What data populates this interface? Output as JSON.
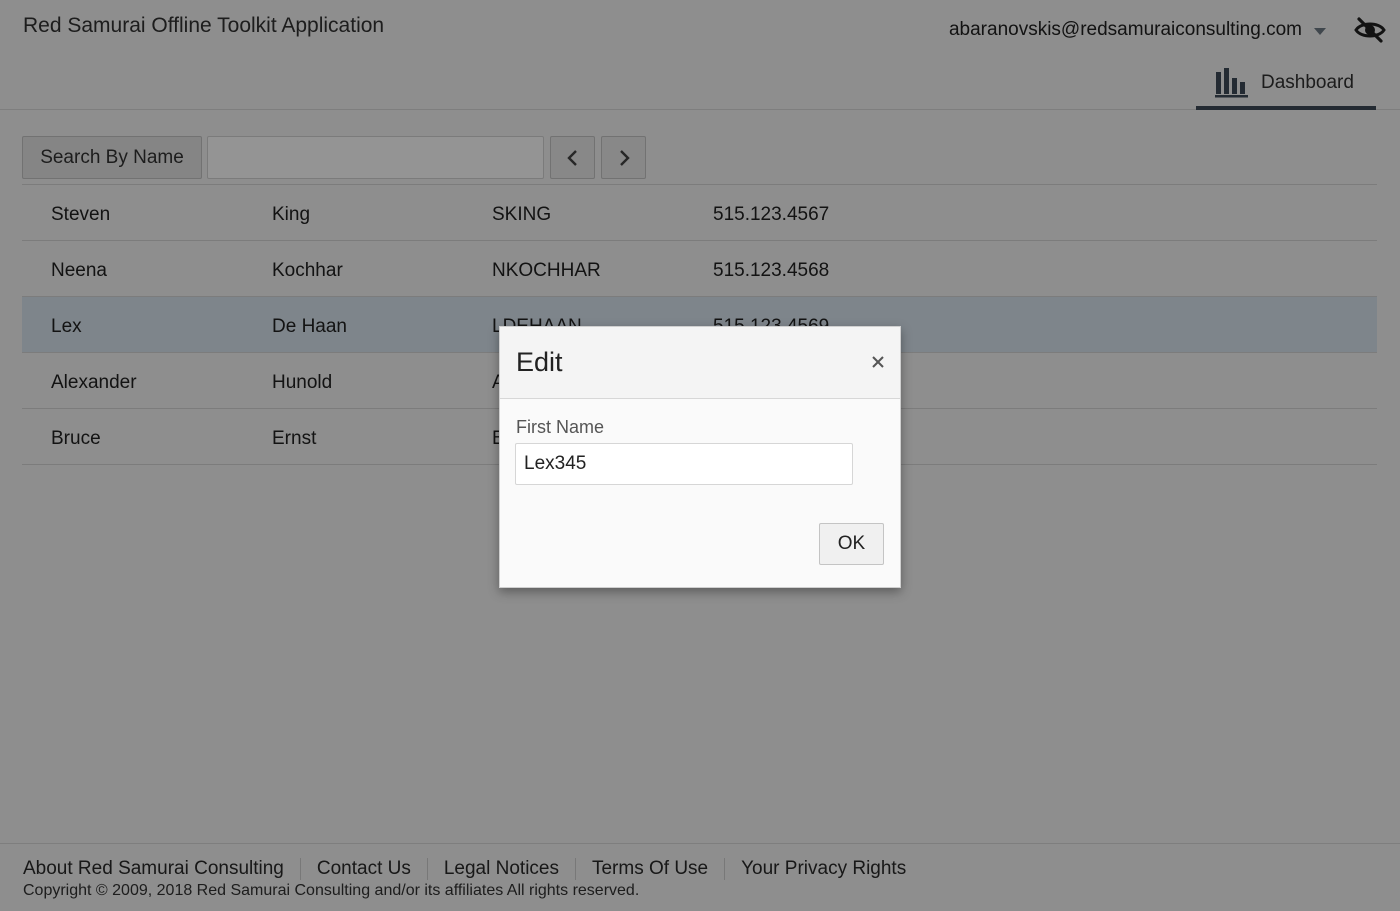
{
  "header": {
    "app_title": "Red Samurai Offline Toolkit Application",
    "user_email": "abaranovskis@redsamuraiconsulting.com",
    "nav_tab_label": "Dashboard"
  },
  "toolbar": {
    "search_button_label": "Search By Name",
    "search_value": ""
  },
  "table": {
    "rows": [
      {
        "first_name": "Steven",
        "last_name": "King",
        "email": "SKING",
        "phone": "515.123.4567",
        "selected": false
      },
      {
        "first_name": "Neena",
        "last_name": "Kochhar",
        "email": "NKOCHHAR",
        "phone": "515.123.4568",
        "selected": false
      },
      {
        "first_name": "Lex",
        "last_name": "De Haan",
        "email": "LDEHAAN",
        "phone": "515.123.4569",
        "selected": true
      },
      {
        "first_name": "Alexander",
        "last_name": "Hunold",
        "email": "A",
        "phone": "",
        "selected": false
      },
      {
        "first_name": "Bruce",
        "last_name": "Ernst",
        "email": "B",
        "phone": "",
        "selected": false
      }
    ]
  },
  "dialog": {
    "title": "Edit",
    "field_label": "First Name",
    "field_value": "Lex345",
    "ok_label": "OK"
  },
  "footer": {
    "links": [
      "About Red Samurai Consulting",
      "Contact Us",
      "Legal Notices",
      "Terms Of Use",
      "Your Privacy Rights"
    ],
    "copyright": "Copyright © 2009, 2018 Red Samurai Consulting and/or its affiliates All rights reserved."
  },
  "colors": {
    "accent": "#3e4a59",
    "selected_row": "#d9e5ef",
    "overlay": "rgba(0,0,0,0.42)"
  },
  "icons": [
    "eye-slash-icon",
    "caret-down-icon",
    "bar-chart-icon",
    "chevron-left-icon",
    "chevron-right-icon",
    "close-icon"
  ]
}
